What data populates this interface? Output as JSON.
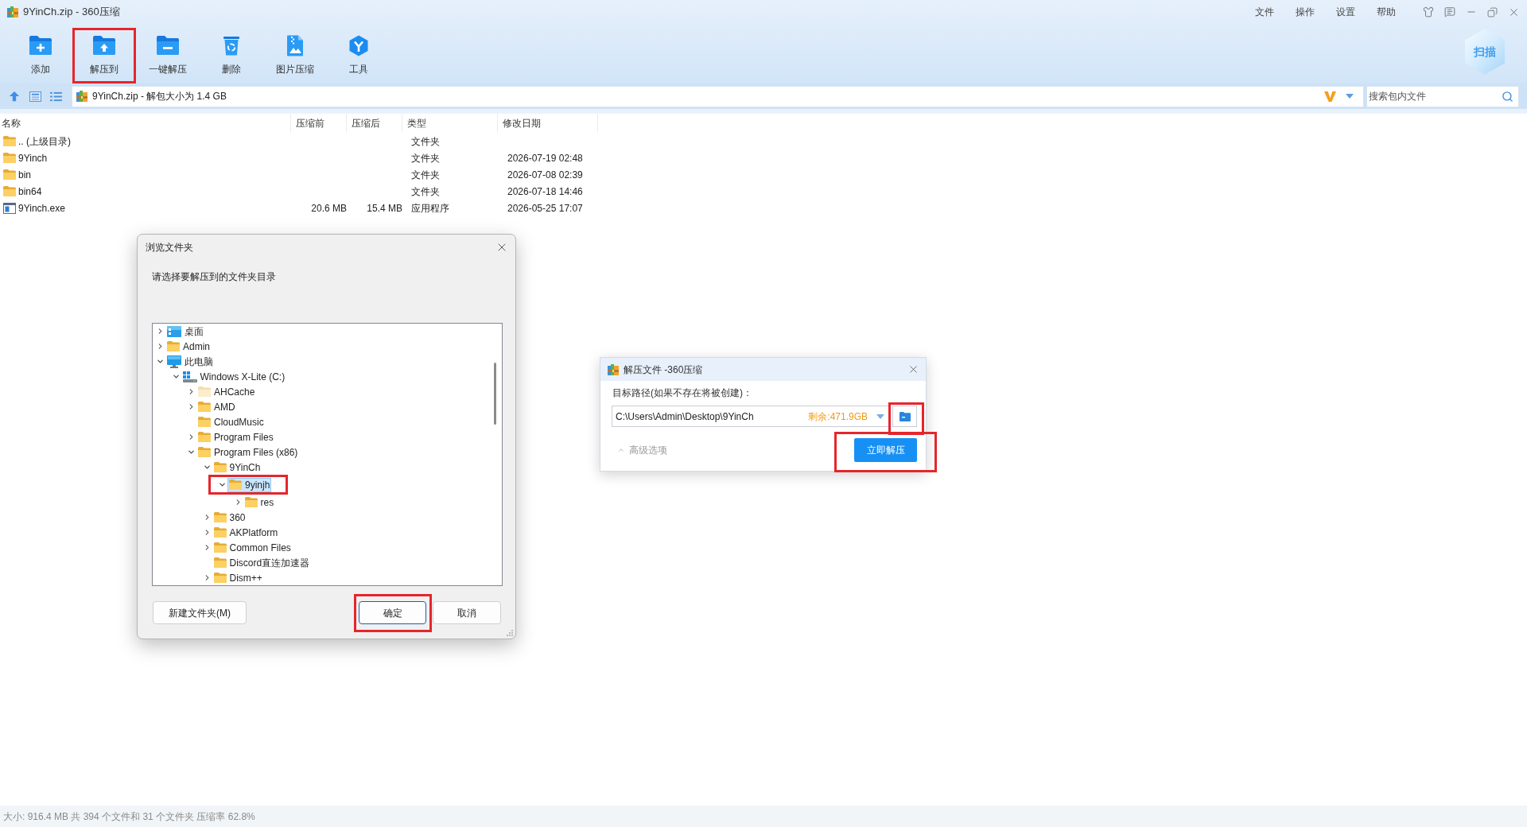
{
  "window": {
    "title": "9YinCh.zip - 360压缩",
    "menu": [
      "文件",
      "操作",
      "设置",
      "帮助"
    ]
  },
  "toolbar": [
    {
      "kind": "add",
      "label": "添加",
      "highlighted": false
    },
    {
      "kind": "extract_to",
      "label": "解压到",
      "highlighted": true
    },
    {
      "kind": "one_click_extract",
      "label": "一键解压",
      "highlighted": false
    },
    {
      "kind": "delete",
      "label": "删除",
      "highlighted": false
    },
    {
      "kind": "image_compress",
      "label": "图片压缩",
      "highlighted": false
    },
    {
      "kind": "tools",
      "label": "工具",
      "highlighted": false
    }
  ],
  "scan_button": {
    "label": "扫描"
  },
  "address_bar": {
    "path": "9YinCh.zip - 解包大小为 1.4 GB"
  },
  "search": {
    "placeholder": "搜索包内文件"
  },
  "file_list": {
    "columns": [
      "名称",
      "压缩前",
      "压缩后",
      "类型",
      "修改日期"
    ],
    "rows": [
      {
        "kind": "folder",
        "name": ".. (上级目录)",
        "type": "文件夹"
      },
      {
        "kind": "folder",
        "name": "9Yinch",
        "type": "文件夹",
        "modified": "2026-07-19 02:48"
      },
      {
        "kind": "folder",
        "name": "bin",
        "type": "文件夹",
        "modified": "2026-07-08 02:39"
      },
      {
        "kind": "folder",
        "name": "bin64",
        "type": "文件夹",
        "modified": "2026-07-18 14:46"
      },
      {
        "kind": "exe",
        "name": "9Yinch.exe",
        "size_before": "20.6 MB",
        "size_after": "15.4 MB",
        "type": "应用程序",
        "modified": "2026-05-25 17:07"
      }
    ]
  },
  "browse_dialog": {
    "title": "浏览文件夹",
    "prompt": "请选择要解压到的文件夹目录",
    "tree": [
      {
        "kind": "desktop",
        "label": "桌面",
        "expandable": true,
        "expanded": false,
        "selected": false,
        "highlighted": false
      },
      {
        "kind": "folder",
        "label": "Admin",
        "expandable": true,
        "expanded": false,
        "selected": false,
        "highlighted": false
      },
      {
        "kind": "computer",
        "label": "此电脑",
        "expandable": true,
        "expanded": true,
        "selected": false,
        "highlighted": false,
        "children": [
          {
            "kind": "drive",
            "label": "Windows X-Lite (C:)",
            "expandable": true,
            "expanded": true,
            "selected": false,
            "highlighted": false,
            "children": [
              {
                "kind": "hidden_folder",
                "label": "AHCache",
                "expandable": true,
                "expanded": false,
                "selected": false,
                "highlighted": false
              },
              {
                "kind": "folder",
                "label": "AMD",
                "expandable": true,
                "expanded": false,
                "selected": false,
                "highlighted": false
              },
              {
                "kind": "folder",
                "label": "CloudMusic",
                "expandable": false,
                "selected": false,
                "highlighted": false
              },
              {
                "kind": "folder",
                "label": "Program Files",
                "expandable": true,
                "expanded": false,
                "selected": false,
                "highlighted": false
              },
              {
                "kind": "folder",
                "label": "Program Files (x86)",
                "expandable": true,
                "expanded": true,
                "selected": false,
                "highlighted": false,
                "children": [
                  {
                    "kind": "folder",
                    "label": "9YinCh",
                    "expandable": true,
                    "expanded": true,
                    "selected": false,
                    "highlighted": false,
                    "children": [
                      {
                        "kind": "folder",
                        "label": "9yinjh",
                        "expandable": true,
                        "expanded": true,
                        "selected": true,
                        "highlighted": true,
                        "children": [
                          {
                            "kind": "folder",
                            "label": "res",
                            "expandable": true,
                            "expanded": false,
                            "selected": false,
                            "highlighted": false
                          }
                        ]
                      }
                    ]
                  },
                  {
                    "kind": "folder",
                    "label": "360",
                    "expandable": true,
                    "expanded": false,
                    "selected": false,
                    "highlighted": false
                  },
                  {
                    "kind": "folder",
                    "label": "AKPlatform",
                    "expandable": true,
                    "expanded": false,
                    "selected": false,
                    "highlighted": false
                  },
                  {
                    "kind": "folder",
                    "label": "Common Files",
                    "expandable": true,
                    "expanded": false,
                    "selected": false,
                    "highlighted": false
                  },
                  {
                    "kind": "folder",
                    "label": "Discord直连加速器",
                    "expandable": false,
                    "selected": false,
                    "highlighted": false
                  },
                  {
                    "kind": "folder",
                    "label": "Dism++",
                    "expandable": true,
                    "expanded": false,
                    "selected": false,
                    "highlighted": false
                  }
                ]
              }
            ]
          }
        ]
      }
    ],
    "buttons": [
      {
        "label": "新建文件夹(M)",
        "default": false,
        "highlighted": false
      },
      {
        "label": "确定",
        "default": true,
        "highlighted": true
      },
      {
        "label": "取消",
        "default": false,
        "highlighted": false
      }
    ]
  },
  "extract_dialog": {
    "title": "解压文件 -360压缩",
    "path_label": "目标路径(如果不存在将被创建)：",
    "path": "C:\\Users\\Admin\\Desktop\\9YinCh",
    "free_space": "剩余:471.9GB",
    "browse_button": {
      "highlighted": true
    },
    "advanced_options": {
      "label": "高级选项"
    },
    "extract_button": {
      "label": "立即解压",
      "highlighted": true
    }
  },
  "status_bar": {
    "text": "大小: 916.4 MB 共 394 个文件和 31 个文件夹 压缩率 62.8%"
  }
}
